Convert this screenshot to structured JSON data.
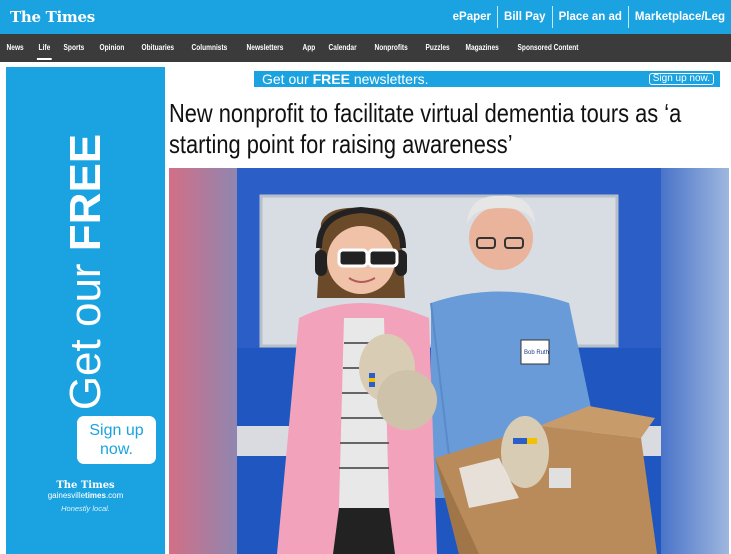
{
  "site": {
    "logo": "The Times"
  },
  "top_links": [
    "ePaper",
    "Bill Pay",
    "Place an ad",
    "Marketplace/Leg"
  ],
  "nav": {
    "items": [
      "News",
      "Life",
      "Sports",
      "Opinion",
      "Obituaries",
      "Columnists",
      "Newsletters",
      "App",
      "Calendar",
      "Nonprofits",
      "Puzzles",
      "Magazines",
      "Sponsored Content"
    ],
    "active": "Life"
  },
  "left_ad": {
    "text_prefix": "Get our ",
    "text_emphasis": "FREE",
    "button_line1": "Sign up",
    "button_line2": "now.",
    "logo": "The Times",
    "domain_pre": "gainesville",
    "domain_bold": "times",
    "domain_post": ".com",
    "tagline": "Honestly local."
  },
  "banner": {
    "text_prefix": "Get our ",
    "text_emphasis": "FREE",
    "text_suffix": " newsletters.",
    "button": "Sign up now."
  },
  "article": {
    "headline": "New nonprofit to facilitate virtual dementia tours as ‘a starting point for raising awareness’",
    "photo_badge_text": "Bob Ruth"
  },
  "colors": {
    "brand_blue": "#1aa3e0",
    "nav_bg": "#3b3b3b",
    "blazer_pink": "#f2a3bb"
  }
}
